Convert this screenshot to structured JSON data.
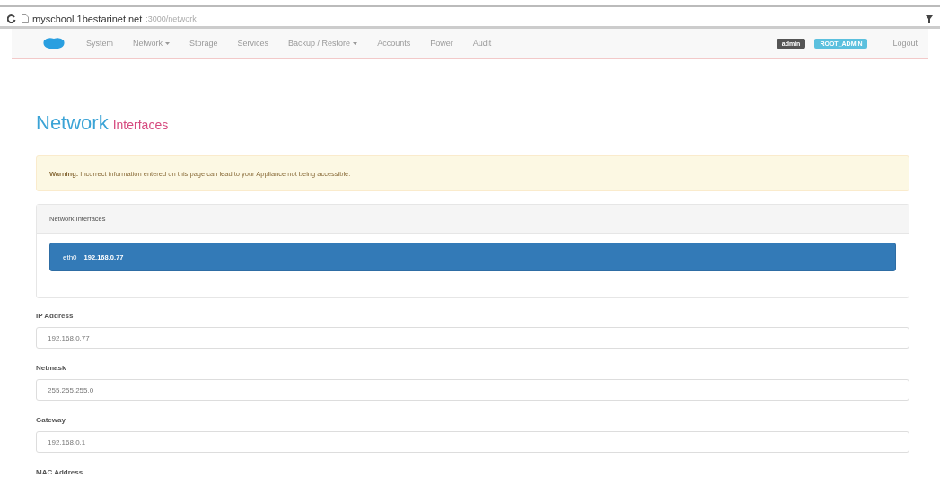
{
  "browser": {
    "url_host": "myschool.1bestarinet.net",
    "url_path": ":3000/network"
  },
  "navbar": {
    "items": [
      {
        "label": "System",
        "dropdown": false
      },
      {
        "label": "Network",
        "dropdown": true
      },
      {
        "label": "Storage",
        "dropdown": false
      },
      {
        "label": "Services",
        "dropdown": false
      },
      {
        "label": "Backup / Restore",
        "dropdown": true
      },
      {
        "label": "Accounts",
        "dropdown": false
      },
      {
        "label": "Power",
        "dropdown": false
      },
      {
        "label": "Audit",
        "dropdown": false
      }
    ],
    "badges": [
      {
        "label": "admin",
        "color": "#555555"
      },
      {
        "label": "ROOT_ADMIN",
        "color": "#5bc0de"
      }
    ],
    "logout": "Logout"
  },
  "page": {
    "title": "Network",
    "subtitle": "Interfaces"
  },
  "alert": {
    "strong": "Warning:",
    "text": "Incorrect information entered on this page can lead to your Appliance not being accessible."
  },
  "panel": {
    "heading": "Network Interfaces",
    "interfaces": [
      {
        "name": "eth0",
        "ip": "192.168.0.77",
        "selected": true
      }
    ]
  },
  "fields": [
    {
      "label": "IP Address",
      "value": "192.168.0.77"
    },
    {
      "label": "Netmask",
      "value": "255.255.255.0"
    },
    {
      "label": "Gateway",
      "value": "192.168.0.1"
    }
  ],
  "trailing_label": "MAC Address"
}
